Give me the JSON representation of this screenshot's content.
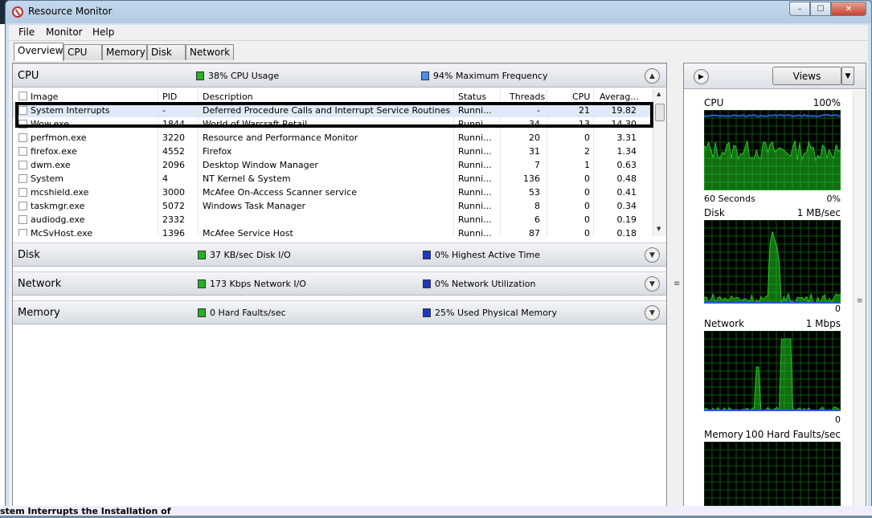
{
  "window": {
    "title": "Resource Monitor",
    "buttons": {
      "minimize": "–",
      "maximize": "☐",
      "close": "✕"
    }
  },
  "menu": [
    "File",
    "Monitor",
    "Help"
  ],
  "tabs": [
    "Overview",
    "CPU",
    "Memory",
    "Disk",
    "Network"
  ],
  "cpu_section": {
    "title": "CPU",
    "metric1": "38% CPU Usage",
    "metric2": "94% Maximum Frequency",
    "columns": [
      "Image",
      "PID",
      "Description",
      "Status",
      "Threads",
      "CPU",
      "Averag..."
    ],
    "rows": [
      {
        "image": "System Interrupts",
        "pid": "-",
        "description": "Deferred Procedure Calls and Interrupt Service Routines",
        "status": "Runni...",
        "threads": "-",
        "cpu": "21",
        "avg": "19.82"
      },
      {
        "image": "Wow.exe",
        "pid": "1844",
        "description": "World of Warcraft Retail",
        "status": "Runni...",
        "threads": "34",
        "cpu": "13",
        "avg": "14.30"
      },
      {
        "image": "perfmon.exe",
        "pid": "3220",
        "description": "Resource and Performance Monitor",
        "status": "Runni...",
        "threads": "20",
        "cpu": "0",
        "avg": "3.31"
      },
      {
        "image": "firefox.exe",
        "pid": "4552",
        "description": "Firefox",
        "status": "Runni...",
        "threads": "31",
        "cpu": "2",
        "avg": "1.34"
      },
      {
        "image": "dwm.exe",
        "pid": "2096",
        "description": "Desktop Window Manager",
        "status": "Runni...",
        "threads": "7",
        "cpu": "1",
        "avg": "0.63"
      },
      {
        "image": "System",
        "pid": "4",
        "description": "NT Kernel & System",
        "status": "Runni...",
        "threads": "136",
        "cpu": "0",
        "avg": "0.48"
      },
      {
        "image": "mcshield.exe",
        "pid": "3000",
        "description": "McAfee On-Access Scanner service",
        "status": "Runni...",
        "threads": "53",
        "cpu": "0",
        "avg": "0.41"
      },
      {
        "image": "taskmgr.exe",
        "pid": "5072",
        "description": "Windows Task Manager",
        "status": "Runni...",
        "threads": "8",
        "cpu": "0",
        "avg": "0.34"
      },
      {
        "image": "audiodg.exe",
        "pid": "2332",
        "description": "",
        "status": "Runni...",
        "threads": "6",
        "cpu": "0",
        "avg": "0.19"
      },
      {
        "image": "McSvHost.exe",
        "pid": "1396",
        "description": "McAfee Service Host",
        "status": "Runni...",
        "threads": "87",
        "cpu": "0",
        "avg": "0.18"
      }
    ]
  },
  "disk_section": {
    "title": "Disk",
    "metric1": "37 KB/sec Disk I/O",
    "metric2": "0% Highest Active Time"
  },
  "network_section": {
    "title": "Network",
    "metric1": "173 Kbps Network I/O",
    "metric2": "0% Network Utilization"
  },
  "memory_section": {
    "title": "Memory",
    "metric1": "0 Hard Faults/sec",
    "metric2": "25% Used Physical Memory"
  },
  "right_panel": {
    "views_label": "Views",
    "graphs": [
      {
        "name": "CPU",
        "max": "100%",
        "foot_left": "60 Seconds",
        "foot_right": "0%"
      },
      {
        "name": "Disk",
        "max": "1 MB/sec",
        "foot_left": "",
        "foot_right": "0"
      },
      {
        "name": "Network",
        "max": "1 Mbps",
        "foot_left": "",
        "foot_right": "0"
      },
      {
        "name": "Memory",
        "max": "100 Hard Faults/sec",
        "foot_left": "",
        "foot_right": ""
      }
    ]
  },
  "bottom_text": "stem Interrupts the Installation of",
  "colors": {
    "graph_green": "#22c822",
    "graph_blue": "#2a5bd8",
    "grid": "#0b5a0b"
  }
}
